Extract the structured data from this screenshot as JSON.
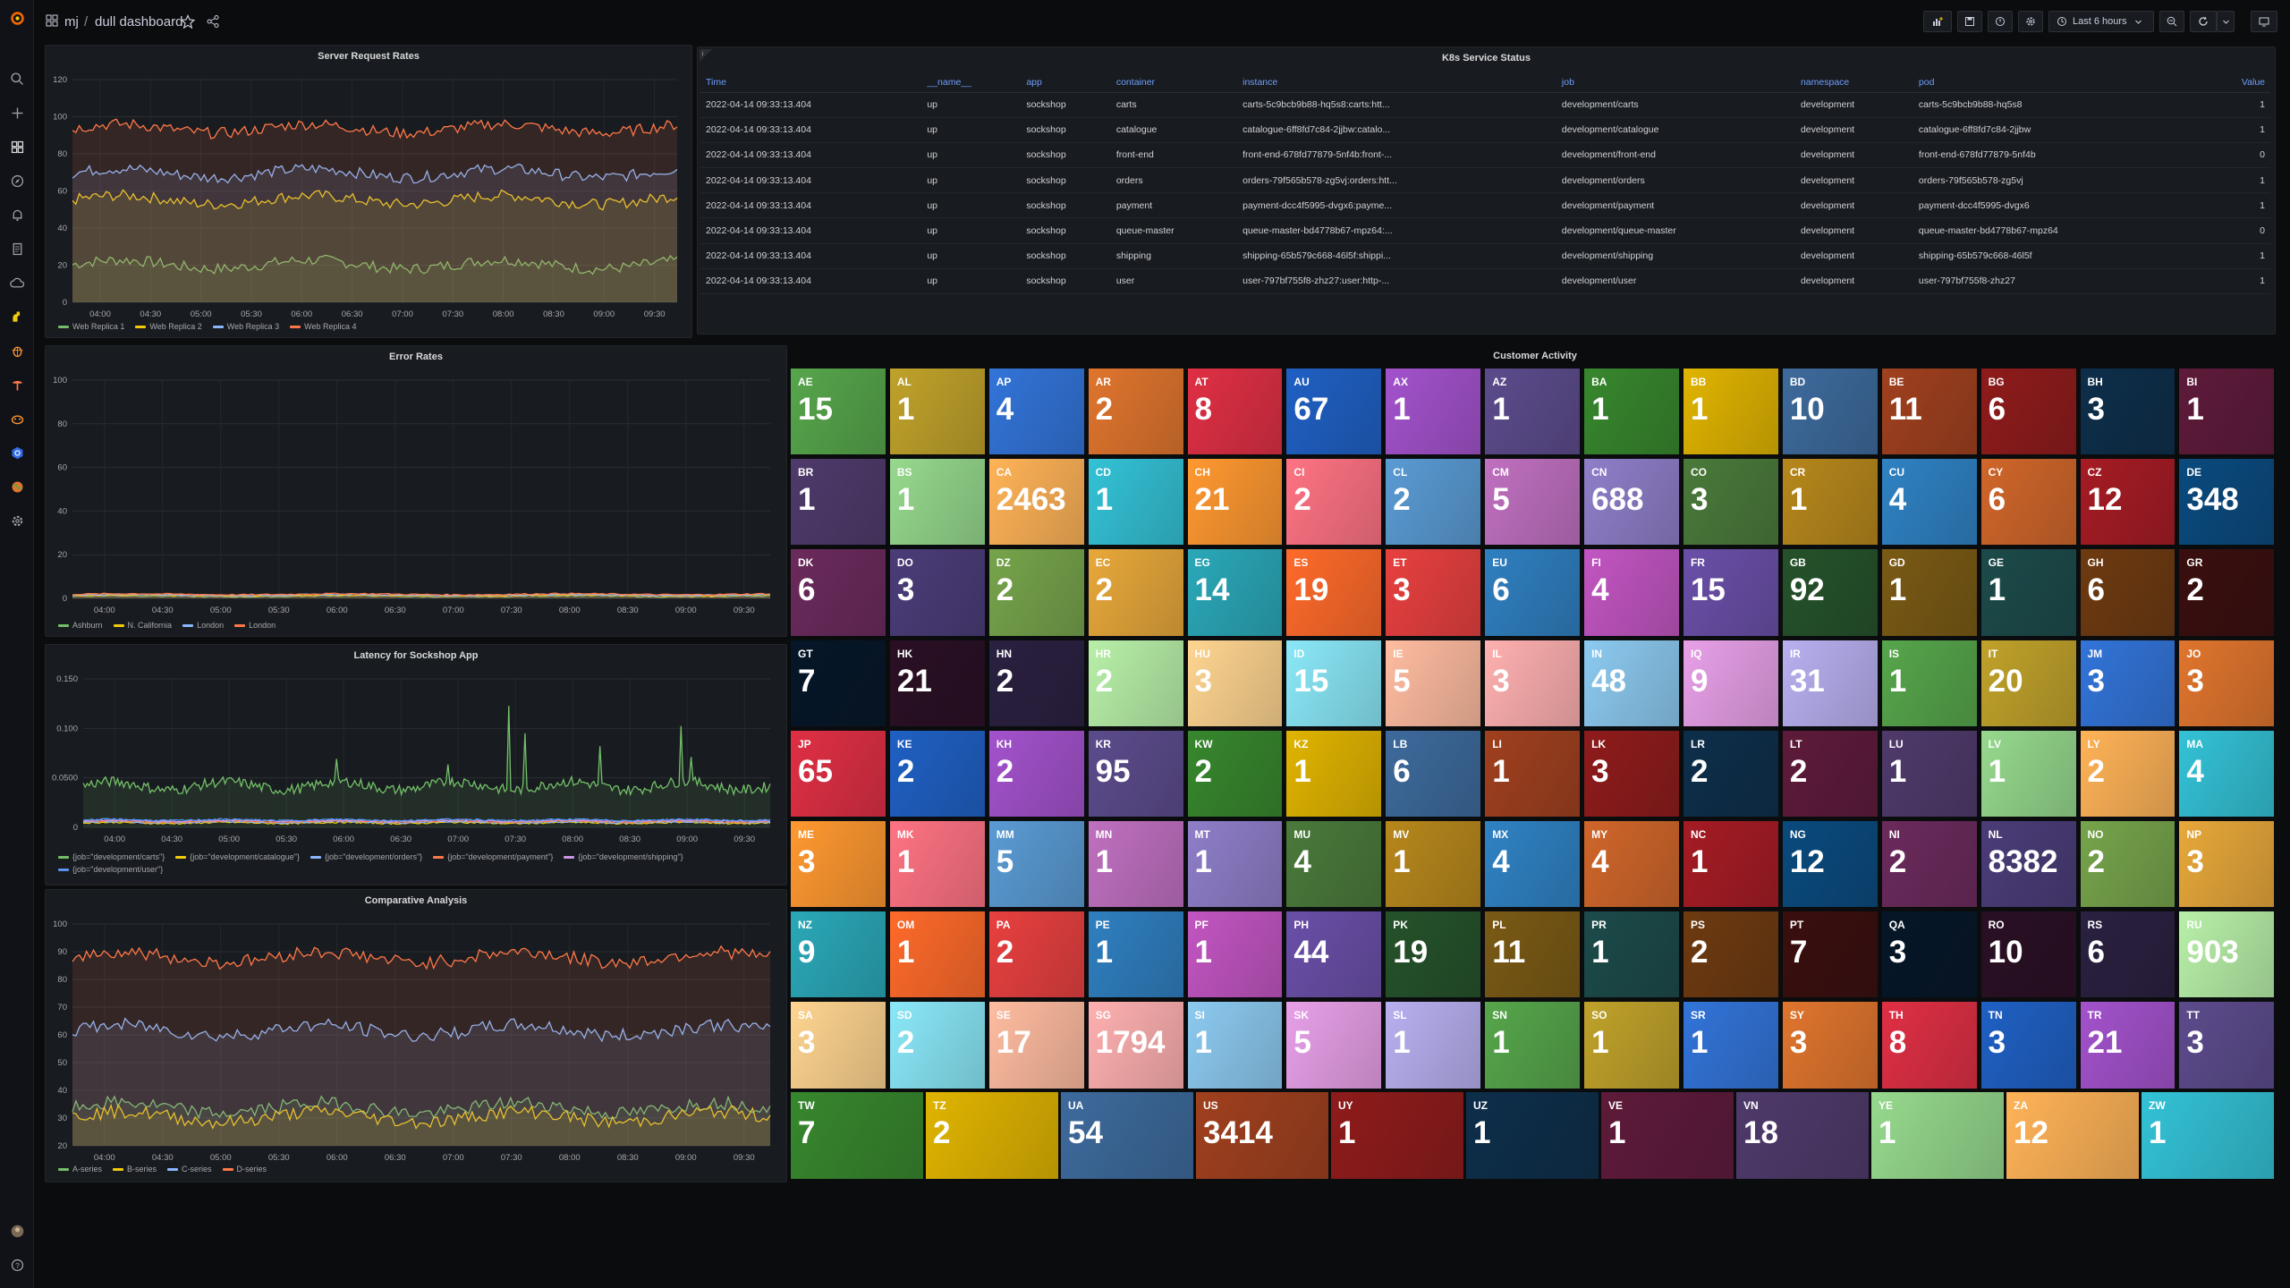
{
  "breadcrumb": {
    "folder": "mj",
    "separator": "/",
    "dashboard": "dull dashboard"
  },
  "toolbar": {
    "time_range": "Last 6 hours"
  },
  "server_panel": {
    "title": "Server Request Rates",
    "y_ticks": [
      "120",
      "100",
      "80",
      "60",
      "40",
      "20",
      "0"
    ],
    "x_ticks": [
      "04:00",
      "04:30",
      "05:00",
      "05:30",
      "06:00",
      "06:30",
      "07:00",
      "07:30",
      "08:00",
      "08:30",
      "09:00",
      "09:30"
    ],
    "legend": [
      {
        "name": "Web Replica 1",
        "color": "#73bf69"
      },
      {
        "name": "Web Replica 2",
        "color": "#f2cc0c"
      },
      {
        "name": "Web Replica 3",
        "color": "#8ab8ff"
      },
      {
        "name": "Web Replica 4",
        "color": "#ff7849"
      }
    ]
  },
  "error_panel": {
    "title": "Error Rates",
    "y_ticks": [
      "100",
      "80",
      "60",
      "40",
      "20",
      "0"
    ],
    "x_ticks": [
      "04:00",
      "04:30",
      "05:00",
      "05:30",
      "06:00",
      "06:30",
      "07:00",
      "07:30",
      "08:00",
      "08:30",
      "09:00",
      "09:30"
    ],
    "legend": [
      {
        "name": "Ashburn",
        "color": "#73bf69"
      },
      {
        "name": "N. California",
        "color": "#f2cc0c"
      },
      {
        "name": "London",
        "color": "#8ab8ff"
      },
      {
        "name": "London",
        "color": "#ff7849"
      }
    ]
  },
  "latency_panel": {
    "title": "Latency for Sockshop App",
    "y_ticks": [
      "0.150",
      "0.100",
      "0.0500",
      "0"
    ],
    "x_ticks": [
      "04:00",
      "04:30",
      "05:00",
      "05:30",
      "06:00",
      "06:30",
      "07:00",
      "07:30",
      "08:00",
      "08:30",
      "09:00",
      "09:30"
    ],
    "legend": [
      {
        "name": "{job=\"development/carts\"}",
        "color": "#73bf69"
      },
      {
        "name": "{job=\"development/catalogue\"}",
        "color": "#f2cc0c"
      },
      {
        "name": "{job=\"development/orders\"}",
        "color": "#8ab8ff"
      },
      {
        "name": "{job=\"development/payment\"}",
        "color": "#ff7849"
      },
      {
        "name": "{job=\"development/shipping\"}",
        "color": "#ca95e5"
      },
      {
        "name": "{job=\"development/user\"}",
        "color": "#5794f2"
      }
    ]
  },
  "comparative_panel": {
    "title": "Comparative Analysis",
    "y_ticks": [
      "100",
      "90",
      "80",
      "70",
      "60",
      "50",
      "40",
      "30",
      "20"
    ],
    "x_ticks": [
      "04:00",
      "04:30",
      "05:00",
      "05:30",
      "06:00",
      "06:30",
      "07:00",
      "07:30",
      "08:00",
      "08:30",
      "09:00",
      "09:30"
    ],
    "legend": [
      {
        "name": "A-series",
        "color": "#73bf69"
      },
      {
        "name": "B-series",
        "color": "#f2cc0c"
      },
      {
        "name": "C-series",
        "color": "#8ab8ff"
      },
      {
        "name": "D-series",
        "color": "#ff7849"
      }
    ]
  },
  "k8s": {
    "title": "K8s Service Status",
    "columns": [
      "Time",
      "__name__",
      "app",
      "container",
      "instance",
      "job",
      "namespace",
      "pod",
      "Value"
    ],
    "rows": [
      [
        "2022-04-14 09:33:13.404",
        "up",
        "sockshop",
        "carts",
        "carts-5c9bcb9b88-hq5s8:carts:htt...",
        "development/carts",
        "development",
        "carts-5c9bcb9b88-hq5s8",
        "1"
      ],
      [
        "2022-04-14 09:33:13.404",
        "up",
        "sockshop",
        "catalogue",
        "catalogue-6ff8fd7c84-2jjbw:catalo...",
        "development/catalogue",
        "development",
        "catalogue-6ff8fd7c84-2jjbw",
        "1"
      ],
      [
        "2022-04-14 09:33:13.404",
        "up",
        "sockshop",
        "front-end",
        "front-end-678fd77879-5nf4b:front-...",
        "development/front-end",
        "development",
        "front-end-678fd77879-5nf4b",
        "0"
      ],
      [
        "2022-04-14 09:33:13.404",
        "up",
        "sockshop",
        "orders",
        "orders-79f565b578-zg5vj:orders:htt...",
        "development/orders",
        "development",
        "orders-79f565b578-zg5vj",
        "1"
      ],
      [
        "2022-04-14 09:33:13.404",
        "up",
        "sockshop",
        "payment",
        "payment-dcc4f5995-dvgx6:payme...",
        "development/payment",
        "development",
        "payment-dcc4f5995-dvgx6",
        "1"
      ],
      [
        "2022-04-14 09:33:13.404",
        "up",
        "sockshop",
        "queue-master",
        "queue-master-bd4778b67-mpz64:...",
        "development/queue-master",
        "development",
        "queue-master-bd4778b67-mpz64",
        "0"
      ],
      [
        "2022-04-14 09:33:13.404",
        "up",
        "sockshop",
        "shipping",
        "shipping-65b579c668-46l5f:shippi...",
        "development/shipping",
        "development",
        "shipping-65b579c668-46l5f",
        "1"
      ],
      [
        "2022-04-14 09:33:13.404",
        "up",
        "sockshop",
        "user",
        "user-797bf755f8-zhz27:user:http-...",
        "development/user",
        "development",
        "user-797bf755f8-zhz27",
        "1"
      ]
    ]
  },
  "customer": {
    "title": "Customer Activity",
    "tiles": [
      {
        "code": "AE",
        "value": "15",
        "color": "#56a64b"
      },
      {
        "code": "AL",
        "value": "1",
        "color": "#c0a22a"
      },
      {
        "code": "AP",
        "value": "4",
        "color": "#3274d9"
      },
      {
        "code": "AR",
        "value": "2",
        "color": "#e0752d"
      },
      {
        "code": "AT",
        "value": "8",
        "color": "#e02f44"
      },
      {
        "code": "AU",
        "value": "67",
        "color": "#1f60c4"
      },
      {
        "code": "AX",
        "value": "1",
        "color": "#a352cc"
      },
      {
        "code": "AZ",
        "value": "1",
        "color": "#5c4b8c"
      },
      {
        "code": "BA",
        "value": "1",
        "color": "#37872d"
      },
      {
        "code": "BB",
        "value": "1",
        "color": "#e0b400"
      },
      {
        "code": "BD",
        "value": "10",
        "color": "#3d6a9c"
      },
      {
        "code": "BE",
        "value": "11",
        "color": "#a0401e"
      },
      {
        "code": "BG",
        "value": "6",
        "color": "#8f1b1b"
      },
      {
        "code": "BH",
        "value": "3",
        "color": "#0d2e4a"
      },
      {
        "code": "BI",
        "value": "1",
        "color": "#5e1a3a"
      },
      {
        "code": "BR",
        "value": "1",
        "color": "#4f3a6b"
      },
      {
        "code": "BS",
        "value": "1",
        "color": "#96d98d"
      },
      {
        "code": "CA",
        "value": "2463",
        "color": "#ffb357"
      },
      {
        "code": "CD",
        "value": "1",
        "color": "#33c2d6"
      },
      {
        "code": "CH",
        "value": "21",
        "color": "#ff9830"
      },
      {
        "code": "CI",
        "value": "2",
        "color": "#ff7383"
      },
      {
        "code": "CL",
        "value": "2",
        "color": "#5a9bd4"
      },
      {
        "code": "CM",
        "value": "5",
        "color": "#c070c0"
      },
      {
        "code": "CN",
        "value": "688",
        "color": "#8f7ec9"
      },
      {
        "code": "CO",
        "value": "3",
        "color": "#4a7a3a"
      },
      {
        "code": "CR",
        "value": "1",
        "color": "#b7871b"
      },
      {
        "code": "CU",
        "value": "4",
        "color": "#2f82c4"
      },
      {
        "code": "CY",
        "value": "6",
        "color": "#d0662a"
      },
      {
        "code": "CZ",
        "value": "12",
        "color": "#a61b24"
      },
      {
        "code": "DE",
        "value": "348",
        "color": "#0a4a7e"
      },
      {
        "code": "DK",
        "value": "6",
        "color": "#6b2a5c"
      },
      {
        "code": "DO",
        "value": "3",
        "color": "#4b3c78"
      },
      {
        "code": "DZ",
        "value": "2",
        "color": "#76a44b"
      },
      {
        "code": "EC",
        "value": "2",
        "color": "#e8a83a"
      },
      {
        "code": "EG",
        "value": "14",
        "color": "#2aa8b8"
      },
      {
        "code": "ES",
        "value": "19",
        "color": "#ff6a2a"
      },
      {
        "code": "ET",
        "value": "3",
        "color": "#e8403f"
      },
      {
        "code": "EU",
        "value": "6",
        "color": "#2f7fc0"
      },
      {
        "code": "FI",
        "value": "4",
        "color": "#c255c2"
      },
      {
        "code": "FR",
        "value": "15",
        "color": "#6a4fa8"
      },
      {
        "code": "GB",
        "value": "92",
        "color": "#25522a"
      },
      {
        "code": "GD",
        "value": "1",
        "color": "#7a5a14"
      },
      {
        "code": "GE",
        "value": "1",
        "color": "#1c4a4a"
      },
      {
        "code": "GH",
        "value": "6",
        "color": "#6e3a10"
      },
      {
        "code": "GR",
        "value": "2",
        "color": "#3a0e0e"
      },
      {
        "code": "GT",
        "value": "7",
        "color": "#061628"
      },
      {
        "code": "HK",
        "value": "21",
        "color": "#2a0f24"
      },
      {
        "code": "HN",
        "value": "2",
        "color": "#2a2040"
      },
      {
        "code": "HR",
        "value": "2",
        "color": "#b8f0a8"
      },
      {
        "code": "HU",
        "value": "3",
        "color": "#ffd590"
      },
      {
        "code": "ID",
        "value": "15",
        "color": "#8ae8f8"
      },
      {
        "code": "IE",
        "value": "5",
        "color": "#ffbca0"
      },
      {
        "code": "IL",
        "value": "3",
        "color": "#ffb0b0"
      },
      {
        "code": "IN",
        "value": "48",
        "color": "#8ccaf0"
      },
      {
        "code": "IQ",
        "value": "9",
        "color": "#e8a0e8"
      },
      {
        "code": "IR",
        "value": "31",
        "color": "#b8b0f0"
      },
      {
        "code": "IS",
        "value": "1",
        "color": "#56a64b"
      },
      {
        "code": "IT",
        "value": "20",
        "color": "#c0a22a"
      },
      {
        "code": "JM",
        "value": "3",
        "color": "#3274d9"
      },
      {
        "code": "JO",
        "value": "3",
        "color": "#e0752d"
      },
      {
        "code": "JP",
        "value": "65",
        "color": "#e02f44"
      },
      {
        "code": "KE",
        "value": "2",
        "color": "#1f60c4"
      },
      {
        "code": "KH",
        "value": "2",
        "color": "#a352cc"
      },
      {
        "code": "KR",
        "value": "95",
        "color": "#5c4b8c"
      },
      {
        "code": "KW",
        "value": "2",
        "color": "#37872d"
      },
      {
        "code": "KZ",
        "value": "1",
        "color": "#e0b400"
      },
      {
        "code": "LB",
        "value": "6",
        "color": "#3d6a9c"
      },
      {
        "code": "LI",
        "value": "1",
        "color": "#a0401e"
      },
      {
        "code": "LK",
        "value": "3",
        "color": "#8f1b1b"
      },
      {
        "code": "LR",
        "value": "2",
        "color": "#0d2e4a"
      },
      {
        "code": "LT",
        "value": "2",
        "color": "#5e1a3a"
      },
      {
        "code": "LU",
        "value": "1",
        "color": "#4f3a6b"
      },
      {
        "code": "LV",
        "value": "1",
        "color": "#96d98d"
      },
      {
        "code": "LY",
        "value": "2",
        "color": "#ffb357"
      },
      {
        "code": "MA",
        "value": "4",
        "color": "#33c2d6"
      },
      {
        "code": "ME",
        "value": "3",
        "color": "#ff9830"
      },
      {
        "code": "MK",
        "value": "1",
        "color": "#ff7383"
      },
      {
        "code": "MM",
        "value": "5",
        "color": "#5a9bd4"
      },
      {
        "code": "MN",
        "value": "1",
        "color": "#c070c0"
      },
      {
        "code": "MT",
        "value": "1",
        "color": "#8f7ec9"
      },
      {
        "code": "MU",
        "value": "4",
        "color": "#4a7a3a"
      },
      {
        "code": "MV",
        "value": "1",
        "color": "#b7871b"
      },
      {
        "code": "MX",
        "value": "4",
        "color": "#2f82c4"
      },
      {
        "code": "MY",
        "value": "4",
        "color": "#d0662a"
      },
      {
        "code": "NC",
        "value": "1",
        "color": "#a61b24"
      },
      {
        "code": "NG",
        "value": "12",
        "color": "#0a4a7e"
      },
      {
        "code": "NI",
        "value": "2",
        "color": "#6b2a5c"
      },
      {
        "code": "NL",
        "value": "8382",
        "color": "#4b3c78"
      },
      {
        "code": "NO",
        "value": "2",
        "color": "#76a44b"
      },
      {
        "code": "NP",
        "value": "3",
        "color": "#e8a83a"
      },
      {
        "code": "NZ",
        "value": "9",
        "color": "#2aa8b8"
      },
      {
        "code": "OM",
        "value": "1",
        "color": "#ff6a2a"
      },
      {
        "code": "PA",
        "value": "2",
        "color": "#e8403f"
      },
      {
        "code": "PE",
        "value": "1",
        "color": "#2f7fc0"
      },
      {
        "code": "PF",
        "value": "1",
        "color": "#c255c2"
      },
      {
        "code": "PH",
        "value": "44",
        "color": "#6a4fa8"
      },
      {
        "code": "PK",
        "value": "19",
        "color": "#25522a"
      },
      {
        "code": "PL",
        "value": "11",
        "color": "#7a5a14"
      },
      {
        "code": "PR",
        "value": "1",
        "color": "#1c4a4a"
      },
      {
        "code": "PS",
        "value": "2",
        "color": "#6e3a10"
      },
      {
        "code": "PT",
        "value": "7",
        "color": "#3a0e0e"
      },
      {
        "code": "QA",
        "value": "3",
        "color": "#061628"
      },
      {
        "code": "RO",
        "value": "10",
        "color": "#2a0f24"
      },
      {
        "code": "RS",
        "value": "6",
        "color": "#2a2040"
      },
      {
        "code": "RU",
        "value": "903",
        "color": "#b8f0a8"
      },
      {
        "code": "SA",
        "value": "3",
        "color": "#ffd590"
      },
      {
        "code": "SD",
        "value": "2",
        "color": "#8ae8f8"
      },
      {
        "code": "SE",
        "value": "17",
        "color": "#ffbca0"
      },
      {
        "code": "SG",
        "value": "1794",
        "color": "#ffb0b0"
      },
      {
        "code": "SI",
        "value": "1",
        "color": "#8ccaf0"
      },
      {
        "code": "SK",
        "value": "5",
        "color": "#e8a0e8"
      },
      {
        "code": "SL",
        "value": "1",
        "color": "#b8b0f0"
      },
      {
        "code": "SN",
        "value": "1",
        "color": "#56a64b"
      },
      {
        "code": "SO",
        "value": "1",
        "color": "#c0a22a"
      },
      {
        "code": "SR",
        "value": "1",
        "color": "#3274d9"
      },
      {
        "code": "SY",
        "value": "3",
        "color": "#e0752d"
      },
      {
        "code": "TH",
        "value": "8",
        "color": "#e02f44"
      },
      {
        "code": "TN",
        "value": "3",
        "color": "#1f60c4"
      },
      {
        "code": "TR",
        "value": "21",
        "color": "#a352cc"
      },
      {
        "code": "TT",
        "value": "3",
        "color": "#5c4b8c"
      },
      {
        "code": "TW",
        "value": "7",
        "color": "#37872d"
      },
      {
        "code": "TZ",
        "value": "2",
        "color": "#e0b400"
      },
      {
        "code": "UA",
        "value": "54",
        "color": "#3d6a9c"
      },
      {
        "code": "US",
        "value": "3414",
        "color": "#a0401e"
      },
      {
        "code": "UY",
        "value": "1",
        "color": "#8f1b1b"
      },
      {
        "code": "UZ",
        "value": "1",
        "color": "#0d2e4a"
      },
      {
        "code": "VE",
        "value": "1",
        "color": "#5e1a3a"
      },
      {
        "code": "VN",
        "value": "18",
        "color": "#4f3a6b"
      },
      {
        "code": "YE",
        "value": "1",
        "color": "#96d98d"
      },
      {
        "code": "ZA",
        "value": "12",
        "color": "#ffb357"
      },
      {
        "code": "ZW",
        "value": "1",
        "color": "#33c2d6"
      }
    ]
  },
  "sidebar_icons": [
    "grafana-logo-icon",
    "search-icon",
    "plus-icon",
    "dashboards-icon",
    "explore-icon",
    "alerting-icon",
    "reports-icon",
    "cloud-icon",
    "plugin-icon",
    "bug-icon",
    "tool-icon",
    "hamster-icon",
    "kubernetes-icon",
    "globe-icon",
    "settings-icon",
    "avatar",
    "help-icon"
  ]
}
